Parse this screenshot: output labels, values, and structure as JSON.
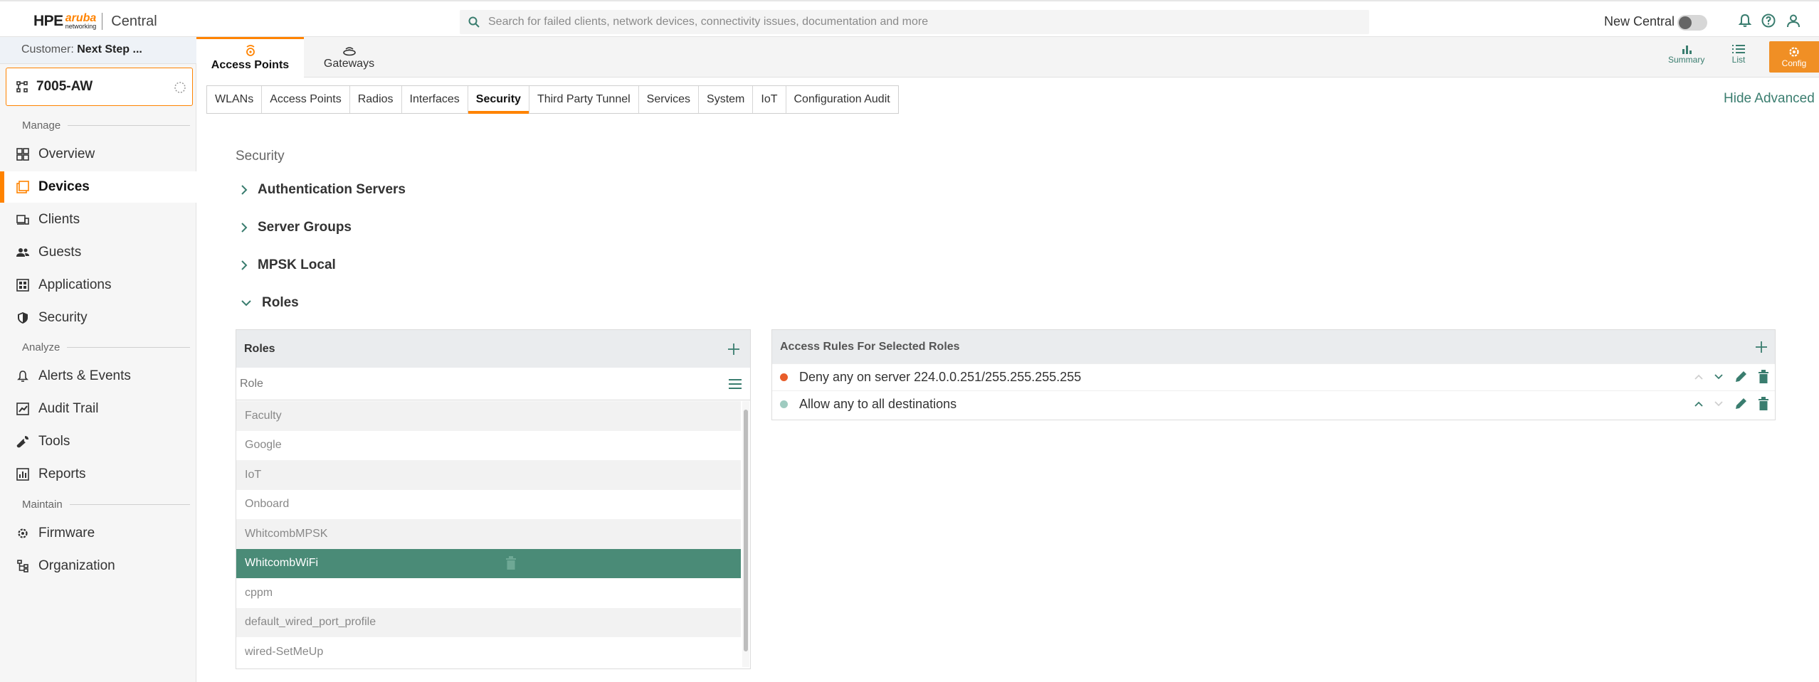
{
  "header": {
    "logo_hpe": "HPE",
    "logo_aruba": "aruba",
    "logo_networking": "networking",
    "logo_central": "Central",
    "search_placeholder": "Search for failed clients, network devices, connectivity issues, documentation and more",
    "new_central_label": "New Central"
  },
  "sidebar": {
    "customer_prefix": "Customer:",
    "customer_name": "Next Step ...",
    "device": "7005-AW",
    "sections": {
      "manage": "Manage",
      "analyze": "Analyze",
      "maintain": "Maintain"
    },
    "items": [
      {
        "label": "Overview",
        "icon": "grid-icon"
      },
      {
        "label": "Devices",
        "icon": "devices-icon"
      },
      {
        "label": "Clients",
        "icon": "clients-icon"
      },
      {
        "label": "Guests",
        "icon": "guests-icon"
      },
      {
        "label": "Applications",
        "icon": "applications-icon"
      },
      {
        "label": "Security",
        "icon": "shield-icon"
      },
      {
        "label": "Alerts & Events",
        "icon": "bell-icon"
      },
      {
        "label": "Audit Trail",
        "icon": "audit-icon"
      },
      {
        "label": "Tools",
        "icon": "wrench-icon"
      },
      {
        "label": "Reports",
        "icon": "reports-icon"
      },
      {
        "label": "Firmware",
        "icon": "gear-icon"
      },
      {
        "label": "Organization",
        "icon": "organization-icon"
      }
    ]
  },
  "main_tabs": [
    {
      "label": "Access Points"
    },
    {
      "label": "Gateways"
    }
  ],
  "right_tools": {
    "summary": "Summary",
    "list": "List",
    "config": "Config"
  },
  "sub_tabs": [
    "WLANs",
    "Access Points",
    "Radios",
    "Interfaces",
    "Security",
    "Third Party Tunnel",
    "Services",
    "System",
    "IoT",
    "Configuration Audit"
  ],
  "hide_advanced": "Hide Advanced",
  "page_title": "Security",
  "accordions": [
    "Authentication Servers",
    "Server Groups",
    "MPSK Local",
    "Roles"
  ],
  "roles": {
    "title": "Roles",
    "filter_placeholder": "Role",
    "items": [
      "Faculty",
      "Google",
      "IoT",
      "Onboard",
      "WhitcombMPSK",
      "WhitcombWiFi",
      "cppm",
      "default_wired_port_profile",
      "wired-SetMeUp"
    ],
    "selected": "WhitcombWiFi"
  },
  "access_rules": {
    "title": "Access Rules For Selected Roles",
    "rules": [
      {
        "text": "Deny any on server 224.0.0.251/255.255.255.255",
        "color": "#e85d2a"
      },
      {
        "text": "Allow any to all destinations",
        "color": "#9fcbc0"
      }
    ]
  },
  "colors": {
    "accent": "#ff8300",
    "teal": "#3a7d6f",
    "selected_row": "#4a8b77"
  }
}
